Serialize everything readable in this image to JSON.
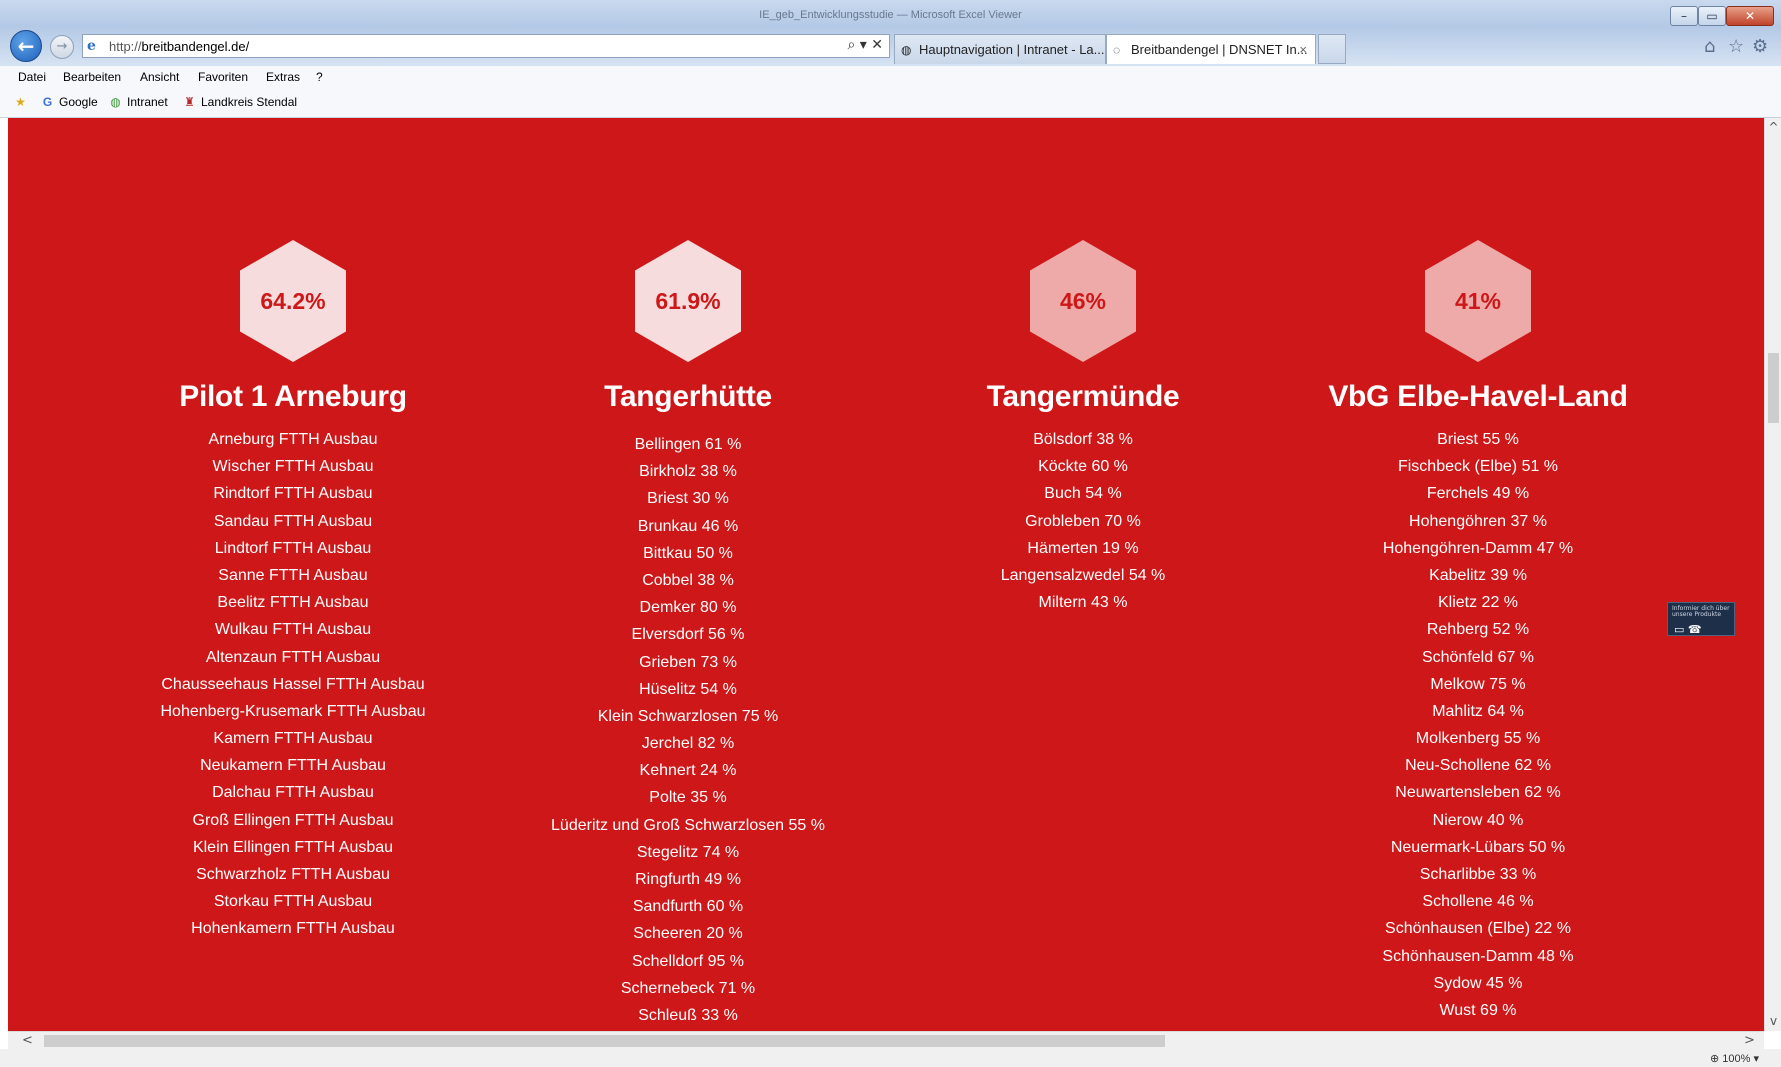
{
  "browser": {
    "window_title": "IE_geb_Entwicklungsstudie — Microsoft Excel Viewer",
    "address_prefix": "http://",
    "address_host": "breitbandengel.de/",
    "address_tools": "⌕ ▾ ✕",
    "tabs": [
      {
        "label": "Hauptnavigation | Intranet - La...",
        "icon": "globe-icon"
      },
      {
        "label": "Breitbandengel | DNSNET In...",
        "icon": "loading-icon",
        "close": "×"
      }
    ],
    "menu": [
      "Datei",
      "Bearbeiten",
      "Ansicht",
      "Favoriten",
      "Extras",
      "?"
    ],
    "favorites": [
      {
        "label": "Google",
        "icon": "google-icon"
      },
      {
        "label": "Intranet",
        "icon": "globe-icon"
      },
      {
        "label": "Landkreis Stendal",
        "icon": "crest-icon"
      }
    ],
    "zoom": "100%"
  },
  "accent_color": "#cd1719",
  "columns": [
    {
      "percent": "64.2%",
      "title": "Pilot 1 Arneburg",
      "items": [
        "Arneburg FTTH Ausbau",
        "Wischer FTTH Ausbau",
        "Rindtorf FTTH Ausbau",
        "Sandau FTTH Ausbau",
        "Lindtorf FTTH Ausbau",
        "Sanne FTTH Ausbau",
        "Beelitz FTTH Ausbau",
        "Wulkau FTTH Ausbau",
        "Altenzaun FTTH Ausbau",
        "Chausseehaus Hassel FTTH Ausbau",
        "Hohenberg-Krusemark FTTH Ausbau",
        "Kamern FTTH Ausbau",
        "Neukamern FTTH Ausbau",
        "Dalchau FTTH Ausbau",
        "Groß Ellingen FTTH Ausbau",
        "Klein Ellingen FTTH Ausbau",
        "Schwarzholz FTTH Ausbau",
        "Storkau FTTH Ausbau",
        "Hohenkamern FTTH Ausbau"
      ]
    },
    {
      "percent": "61.9%",
      "title": "Tangerhütte",
      "items": [
        "Bellingen 61 %",
        "Birkholz 38 %",
        "Briest 30 %",
        "Brunkau 46 %",
        "Bittkau 50 %",
        "Cobbel 38 %",
        "Demker 80 %",
        "Elversdorf 56 %",
        "Grieben 73 %",
        "Hüselitz 54 %",
        "Klein Schwarzlosen 75 %",
        "Jerchel 82 %",
        "Kehnert 24 %",
        "Polte 35 %",
        "Lüderitz und Groß Schwarzlosen 55 %",
        "Stegelitz 74 %",
        "Ringfurth 49 %",
        "Sandfurth 60 %",
        "Scheeren 20 %",
        "Schelldorf 95 %",
        "Schernebeck 71 %",
        "Schleuß 33 %"
      ]
    },
    {
      "percent": "46%",
      "title": "Tangermünde",
      "items": [
        "Bölsdorf 38 %",
        "Köckte 60 %",
        "Buch 54 %",
        "Grobleben 70 %",
        "Hämerten 19 %",
        "Langensalzwedel 54 %",
        "Miltern 43 %"
      ]
    },
    {
      "percent": "41%",
      "title": "VbG Elbe-Havel-Land",
      "items": [
        "Briest 55 %",
        "Fischbeck (Elbe) 51 %",
        "Ferchels 49 %",
        "Hohengöhren 37 %",
        "Hohengöhren-Damm 47 %",
        "Kabelitz 39 %",
        "Klietz 22 %",
        "Rehberg 52 %",
        "Schönfeld 67 %",
        "Melkow 75 %",
        "Mahlitz 64 %",
        "Molkenberg 55 %",
        "Neu-Schollene 62 %",
        "Neuwartensleben 62 %",
        "Nierow 40 %",
        "Neuermark-Lübars 50 %",
        "Scharlibbe 33 %",
        "Schollene 46 %",
        "Schönhausen (Elbe) 22 %",
        "Schönhausen-Damm 48 %",
        "Sydow 45 %",
        "Wust 69 %"
      ]
    }
  ],
  "side_widget": {
    "text": "Informier dich über unsere Produkte"
  }
}
